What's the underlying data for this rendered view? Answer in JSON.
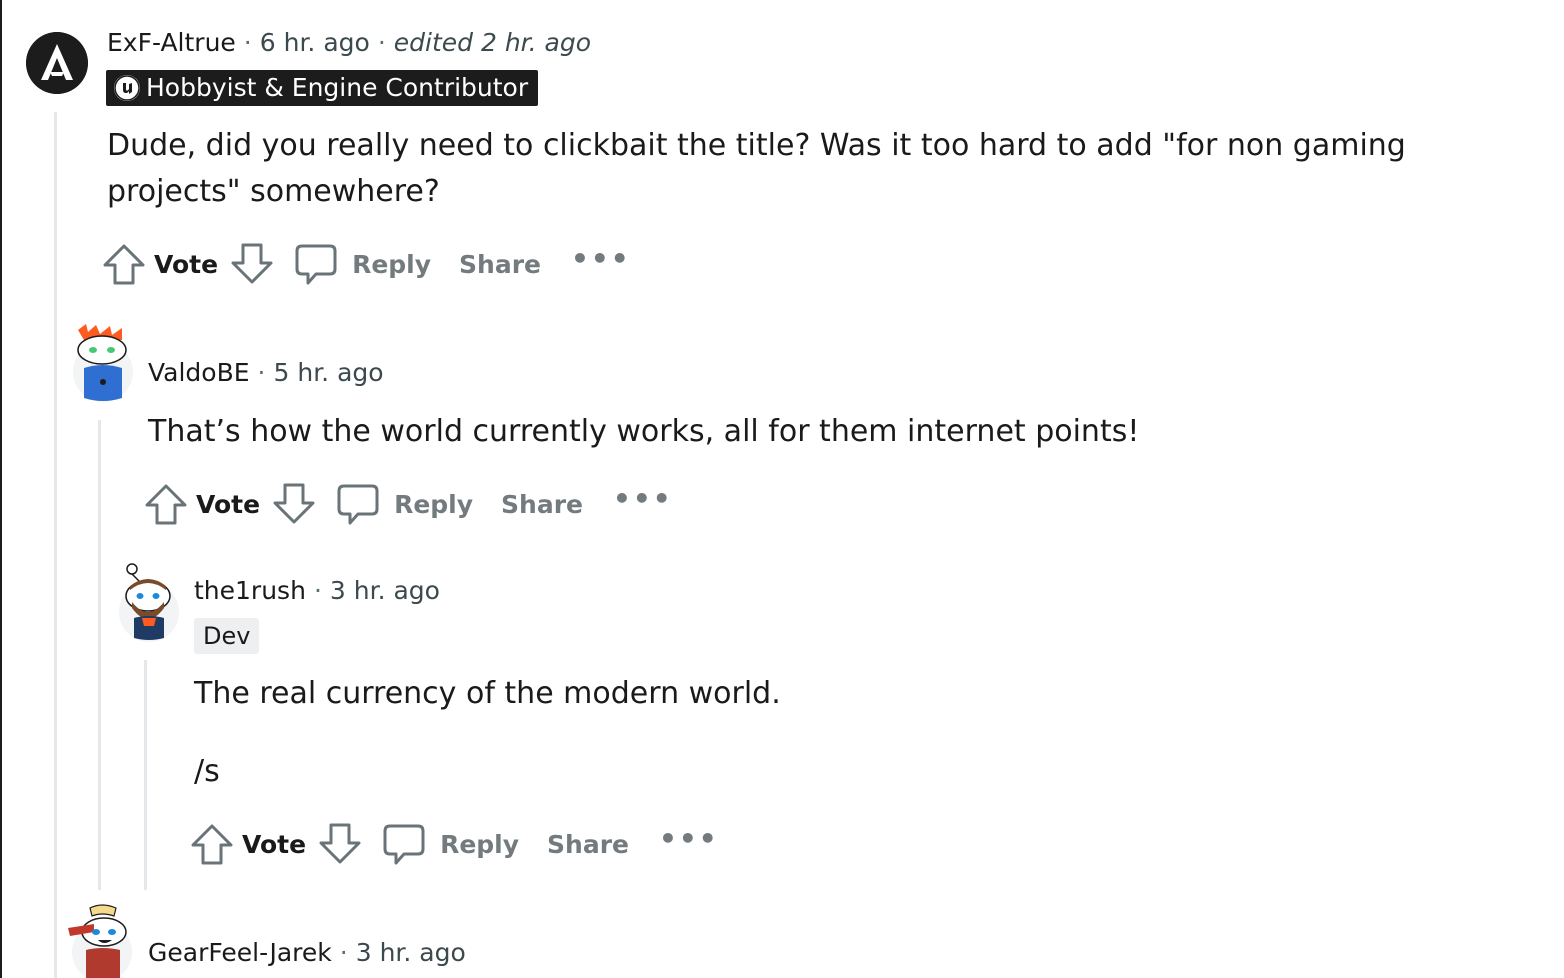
{
  "comments": [
    {
      "author": "ExF-Altrue",
      "time": "6 hr. ago",
      "edited": "edited 2 hr. ago",
      "flair": "Hobbyist & Engine Contributor",
      "body": "Dude, did you really need to clickbait the title? Was it too hard to add \"for non gaming projects\" somewhere?"
    },
    {
      "author": "ValdoBE",
      "time": "5 hr. ago",
      "body": "That’s how the world currently works, all for them internet points!"
    },
    {
      "author": "the1rush",
      "time": "3 hr. ago",
      "flair": "Dev",
      "body_lines": [
        "The real currency of the modern world.",
        "/s"
      ]
    },
    {
      "author": "GearFeel-Jarek",
      "time": "3 hr. ago"
    }
  ],
  "actions": {
    "vote": "Vote",
    "reply": "Reply",
    "share": "Share",
    "more": "•••"
  },
  "separator": "·",
  "icons": {
    "upvote": "arrow-up-icon",
    "downvote": "arrow-down-icon",
    "reply": "speech-bubble-icon",
    "more": "ellipsis-icon",
    "flair_logo": "unreal-engine-logo"
  }
}
